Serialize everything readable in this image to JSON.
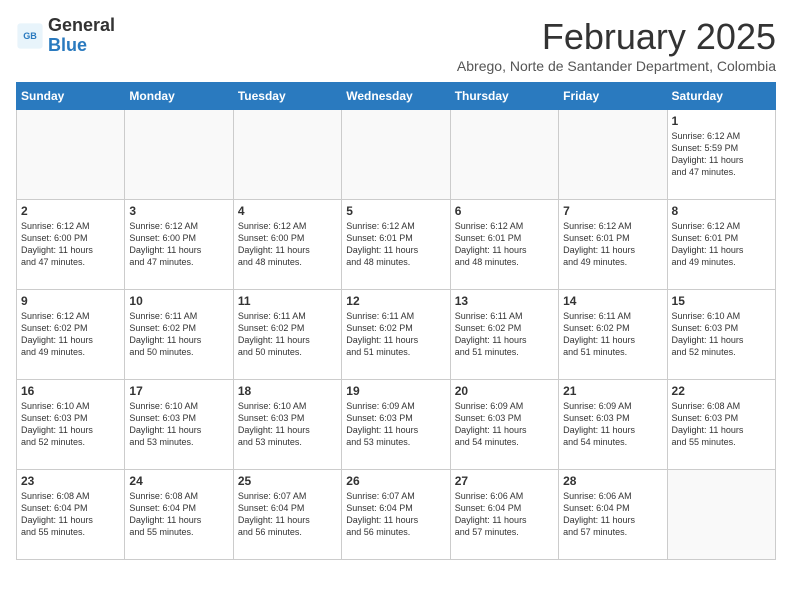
{
  "logo": {
    "general": "General",
    "blue": "Blue"
  },
  "header": {
    "month": "February 2025",
    "subtitle": "Abrego, Norte de Santander Department, Colombia"
  },
  "weekdays": [
    "Sunday",
    "Monday",
    "Tuesday",
    "Wednesday",
    "Thursday",
    "Friday",
    "Saturday"
  ],
  "weeks": [
    [
      {
        "day": "",
        "info": ""
      },
      {
        "day": "",
        "info": ""
      },
      {
        "day": "",
        "info": ""
      },
      {
        "day": "",
        "info": ""
      },
      {
        "day": "",
        "info": ""
      },
      {
        "day": "",
        "info": ""
      },
      {
        "day": "1",
        "info": "Sunrise: 6:12 AM\nSunset: 5:59 PM\nDaylight: 11 hours\nand 47 minutes."
      }
    ],
    [
      {
        "day": "2",
        "info": "Sunrise: 6:12 AM\nSunset: 6:00 PM\nDaylight: 11 hours\nand 47 minutes."
      },
      {
        "day": "3",
        "info": "Sunrise: 6:12 AM\nSunset: 6:00 PM\nDaylight: 11 hours\nand 47 minutes."
      },
      {
        "day": "4",
        "info": "Sunrise: 6:12 AM\nSunset: 6:00 PM\nDaylight: 11 hours\nand 48 minutes."
      },
      {
        "day": "5",
        "info": "Sunrise: 6:12 AM\nSunset: 6:01 PM\nDaylight: 11 hours\nand 48 minutes."
      },
      {
        "day": "6",
        "info": "Sunrise: 6:12 AM\nSunset: 6:01 PM\nDaylight: 11 hours\nand 48 minutes."
      },
      {
        "day": "7",
        "info": "Sunrise: 6:12 AM\nSunset: 6:01 PM\nDaylight: 11 hours\nand 49 minutes."
      },
      {
        "day": "8",
        "info": "Sunrise: 6:12 AM\nSunset: 6:01 PM\nDaylight: 11 hours\nand 49 minutes."
      }
    ],
    [
      {
        "day": "9",
        "info": "Sunrise: 6:12 AM\nSunset: 6:02 PM\nDaylight: 11 hours\nand 49 minutes."
      },
      {
        "day": "10",
        "info": "Sunrise: 6:11 AM\nSunset: 6:02 PM\nDaylight: 11 hours\nand 50 minutes."
      },
      {
        "day": "11",
        "info": "Sunrise: 6:11 AM\nSunset: 6:02 PM\nDaylight: 11 hours\nand 50 minutes."
      },
      {
        "day": "12",
        "info": "Sunrise: 6:11 AM\nSunset: 6:02 PM\nDaylight: 11 hours\nand 51 minutes."
      },
      {
        "day": "13",
        "info": "Sunrise: 6:11 AM\nSunset: 6:02 PM\nDaylight: 11 hours\nand 51 minutes."
      },
      {
        "day": "14",
        "info": "Sunrise: 6:11 AM\nSunset: 6:02 PM\nDaylight: 11 hours\nand 51 minutes."
      },
      {
        "day": "15",
        "info": "Sunrise: 6:10 AM\nSunset: 6:03 PM\nDaylight: 11 hours\nand 52 minutes."
      }
    ],
    [
      {
        "day": "16",
        "info": "Sunrise: 6:10 AM\nSunset: 6:03 PM\nDaylight: 11 hours\nand 52 minutes."
      },
      {
        "day": "17",
        "info": "Sunrise: 6:10 AM\nSunset: 6:03 PM\nDaylight: 11 hours\nand 53 minutes."
      },
      {
        "day": "18",
        "info": "Sunrise: 6:10 AM\nSunset: 6:03 PM\nDaylight: 11 hours\nand 53 minutes."
      },
      {
        "day": "19",
        "info": "Sunrise: 6:09 AM\nSunset: 6:03 PM\nDaylight: 11 hours\nand 53 minutes."
      },
      {
        "day": "20",
        "info": "Sunrise: 6:09 AM\nSunset: 6:03 PM\nDaylight: 11 hours\nand 54 minutes."
      },
      {
        "day": "21",
        "info": "Sunrise: 6:09 AM\nSunset: 6:03 PM\nDaylight: 11 hours\nand 54 minutes."
      },
      {
        "day": "22",
        "info": "Sunrise: 6:08 AM\nSunset: 6:03 PM\nDaylight: 11 hours\nand 55 minutes."
      }
    ],
    [
      {
        "day": "23",
        "info": "Sunrise: 6:08 AM\nSunset: 6:04 PM\nDaylight: 11 hours\nand 55 minutes."
      },
      {
        "day": "24",
        "info": "Sunrise: 6:08 AM\nSunset: 6:04 PM\nDaylight: 11 hours\nand 55 minutes."
      },
      {
        "day": "25",
        "info": "Sunrise: 6:07 AM\nSunset: 6:04 PM\nDaylight: 11 hours\nand 56 minutes."
      },
      {
        "day": "26",
        "info": "Sunrise: 6:07 AM\nSunset: 6:04 PM\nDaylight: 11 hours\nand 56 minutes."
      },
      {
        "day": "27",
        "info": "Sunrise: 6:06 AM\nSunset: 6:04 PM\nDaylight: 11 hours\nand 57 minutes."
      },
      {
        "day": "28",
        "info": "Sunrise: 6:06 AM\nSunset: 6:04 PM\nDaylight: 11 hours\nand 57 minutes."
      },
      {
        "day": "",
        "info": ""
      }
    ]
  ]
}
